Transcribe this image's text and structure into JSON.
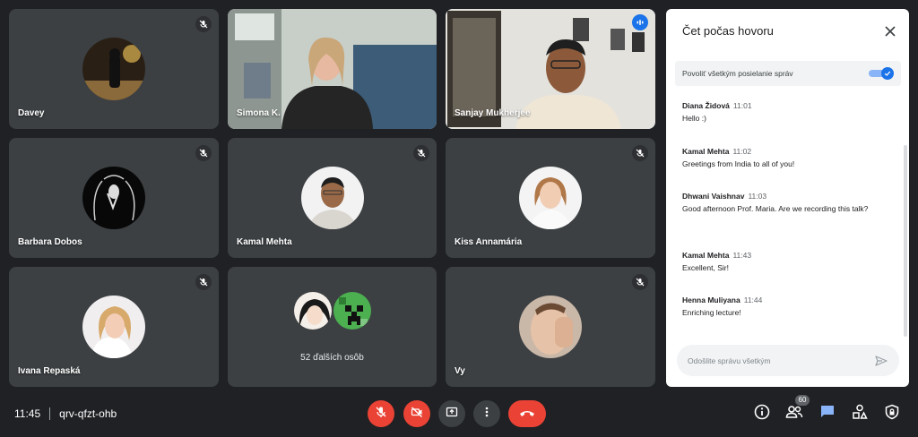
{
  "meeting": {
    "time": "11:45",
    "code": "qrv-qfzt-ohb",
    "people_count": "60"
  },
  "tiles": {
    "davey": {
      "name": "Davey"
    },
    "simona": {
      "name": "Simona K."
    },
    "sanjay": {
      "name": "Sanjay Mukherjee"
    },
    "barbara": {
      "name": "Barbara Dobos"
    },
    "kamal": {
      "name": "Kamal Mehta"
    },
    "kiss": {
      "name": "Kiss Annamária"
    },
    "ivana": {
      "name": "Ivana Repaská"
    },
    "others": {
      "label": "52 ďalších osôb"
    },
    "self": {
      "name": "Vy"
    }
  },
  "chat": {
    "title": "Čet počas hovoru",
    "allow_label": "Povoliť všetkým posielanie správ",
    "allow_enabled": true,
    "messages": [
      {
        "sender": "Diana Židová",
        "time": "11:01",
        "text": "Hello :)"
      },
      {
        "sender": "Kamal Mehta",
        "time": "11:02",
        "text": "Greetings from India to all of you!"
      },
      {
        "sender": "Dhwani Vaishnav",
        "time": "11:03",
        "text": "Good afternoon Prof. Maria. Are we recording this talk?"
      },
      {
        "sender": "Kamal Mehta",
        "time": "11:43",
        "text": "Excellent, Sir!"
      },
      {
        "sender": "Henna Muliyana",
        "time": "11:44",
        "text": "Enriching lecture!"
      }
    ],
    "input_placeholder": "Odošlite správu všetkým"
  },
  "icons": {
    "mic_off": "mic-off-icon",
    "camera_off": "camera-off-icon",
    "present": "present-icon",
    "more": "more-vert-icon",
    "end_call": "end-call-icon",
    "info": "info-icon",
    "people": "people-icon",
    "chat": "chat-icon",
    "activities": "activities-icon",
    "host_controls": "shield-icon"
  },
  "colors": {
    "background": "#202124",
    "tile": "#3c4043",
    "red": "#ea4335",
    "accent": "#1a73e8",
    "active_border": "#8ab4f8"
  }
}
